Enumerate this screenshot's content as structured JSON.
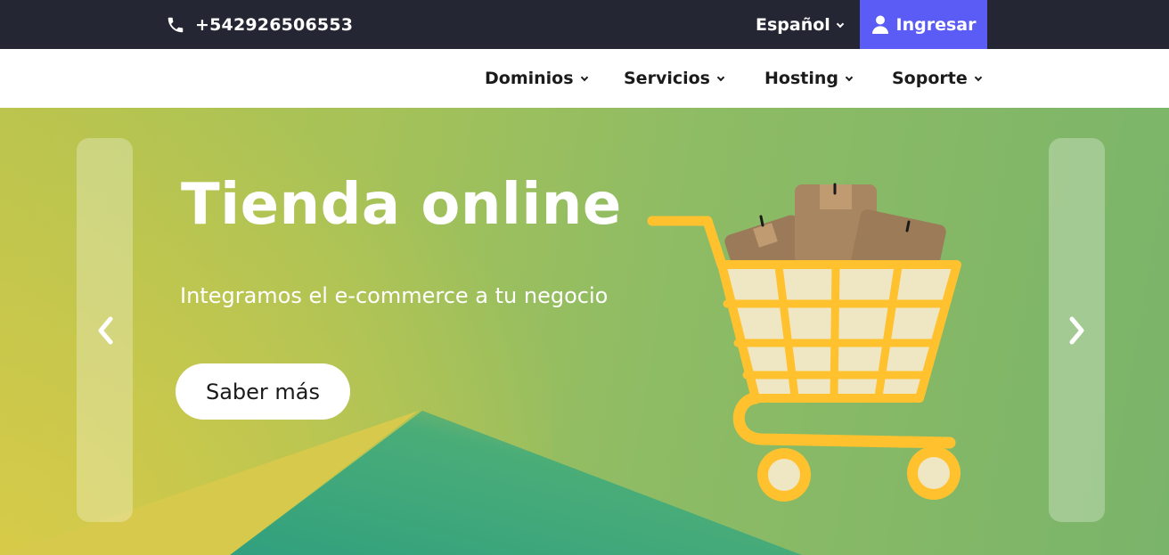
{
  "topbar": {
    "phone": "+542926506553",
    "language": "Español",
    "login_label": "Ingresar"
  },
  "nav": {
    "items": [
      {
        "label": "Dominios"
      },
      {
        "label": "Servicios"
      },
      {
        "label": "Hosting"
      },
      {
        "label": "Soporte"
      }
    ]
  },
  "hero": {
    "title": "Tienda online",
    "subtitle": "Integramos el e-commerce a tu negocio",
    "button_label": "Saber más"
  },
  "icons": {
    "phone": "phone-icon",
    "user": "user-icon",
    "prev": "chevron-left-icon",
    "next": "chevron-right-icon",
    "cart": "shopping-cart-illustration"
  },
  "colors": {
    "topbar_bg": "#242633",
    "login_bg": "#5b5cf6",
    "hero_green": "#8fbc64",
    "hero_yellow": "#d6c94a",
    "hero_teal": "#3aa67d",
    "cart_yellow": "#ffc22e"
  }
}
